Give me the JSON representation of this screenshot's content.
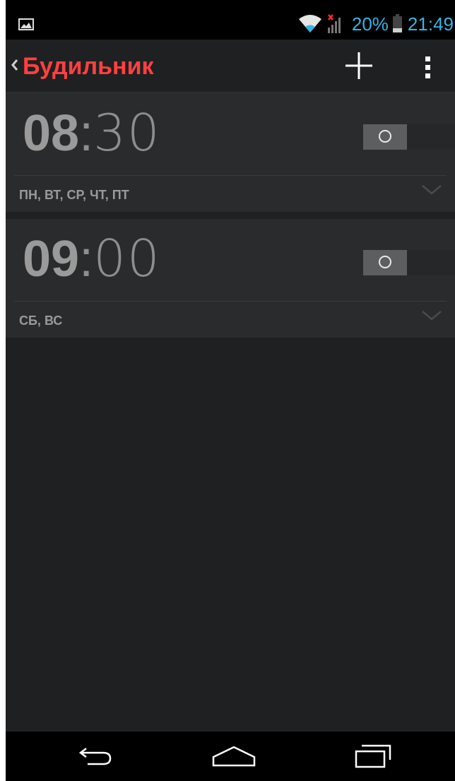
{
  "status_bar": {
    "battery_percent": "20%",
    "time": "21:49",
    "icons": [
      "gallery-notification-icon",
      "wifi-icon",
      "signal-no-service-icon",
      "battery-icon"
    ]
  },
  "action_bar": {
    "title": "Будильник",
    "icons": [
      "back-chevron-icon",
      "add-icon",
      "overflow-menu-icon"
    ]
  },
  "alarms": [
    {
      "hours": "08",
      "separator": ":",
      "minutes": "30",
      "days": "ПН, ВТ, СР, ЧТ, ПТ",
      "enabled": false
    },
    {
      "hours": "09",
      "separator": ":",
      "minutes": "00",
      "days": "СБ, ВС",
      "enabled": false
    }
  ],
  "nav_bar": {
    "icons": [
      "nav-back-icon",
      "nav-home-icon",
      "nav-recent-apps-icon"
    ]
  },
  "colors": {
    "title_accent": "#ff4040",
    "status_text": "#33b5e5",
    "background": "#1f2021",
    "card": "#2a2b2c"
  }
}
